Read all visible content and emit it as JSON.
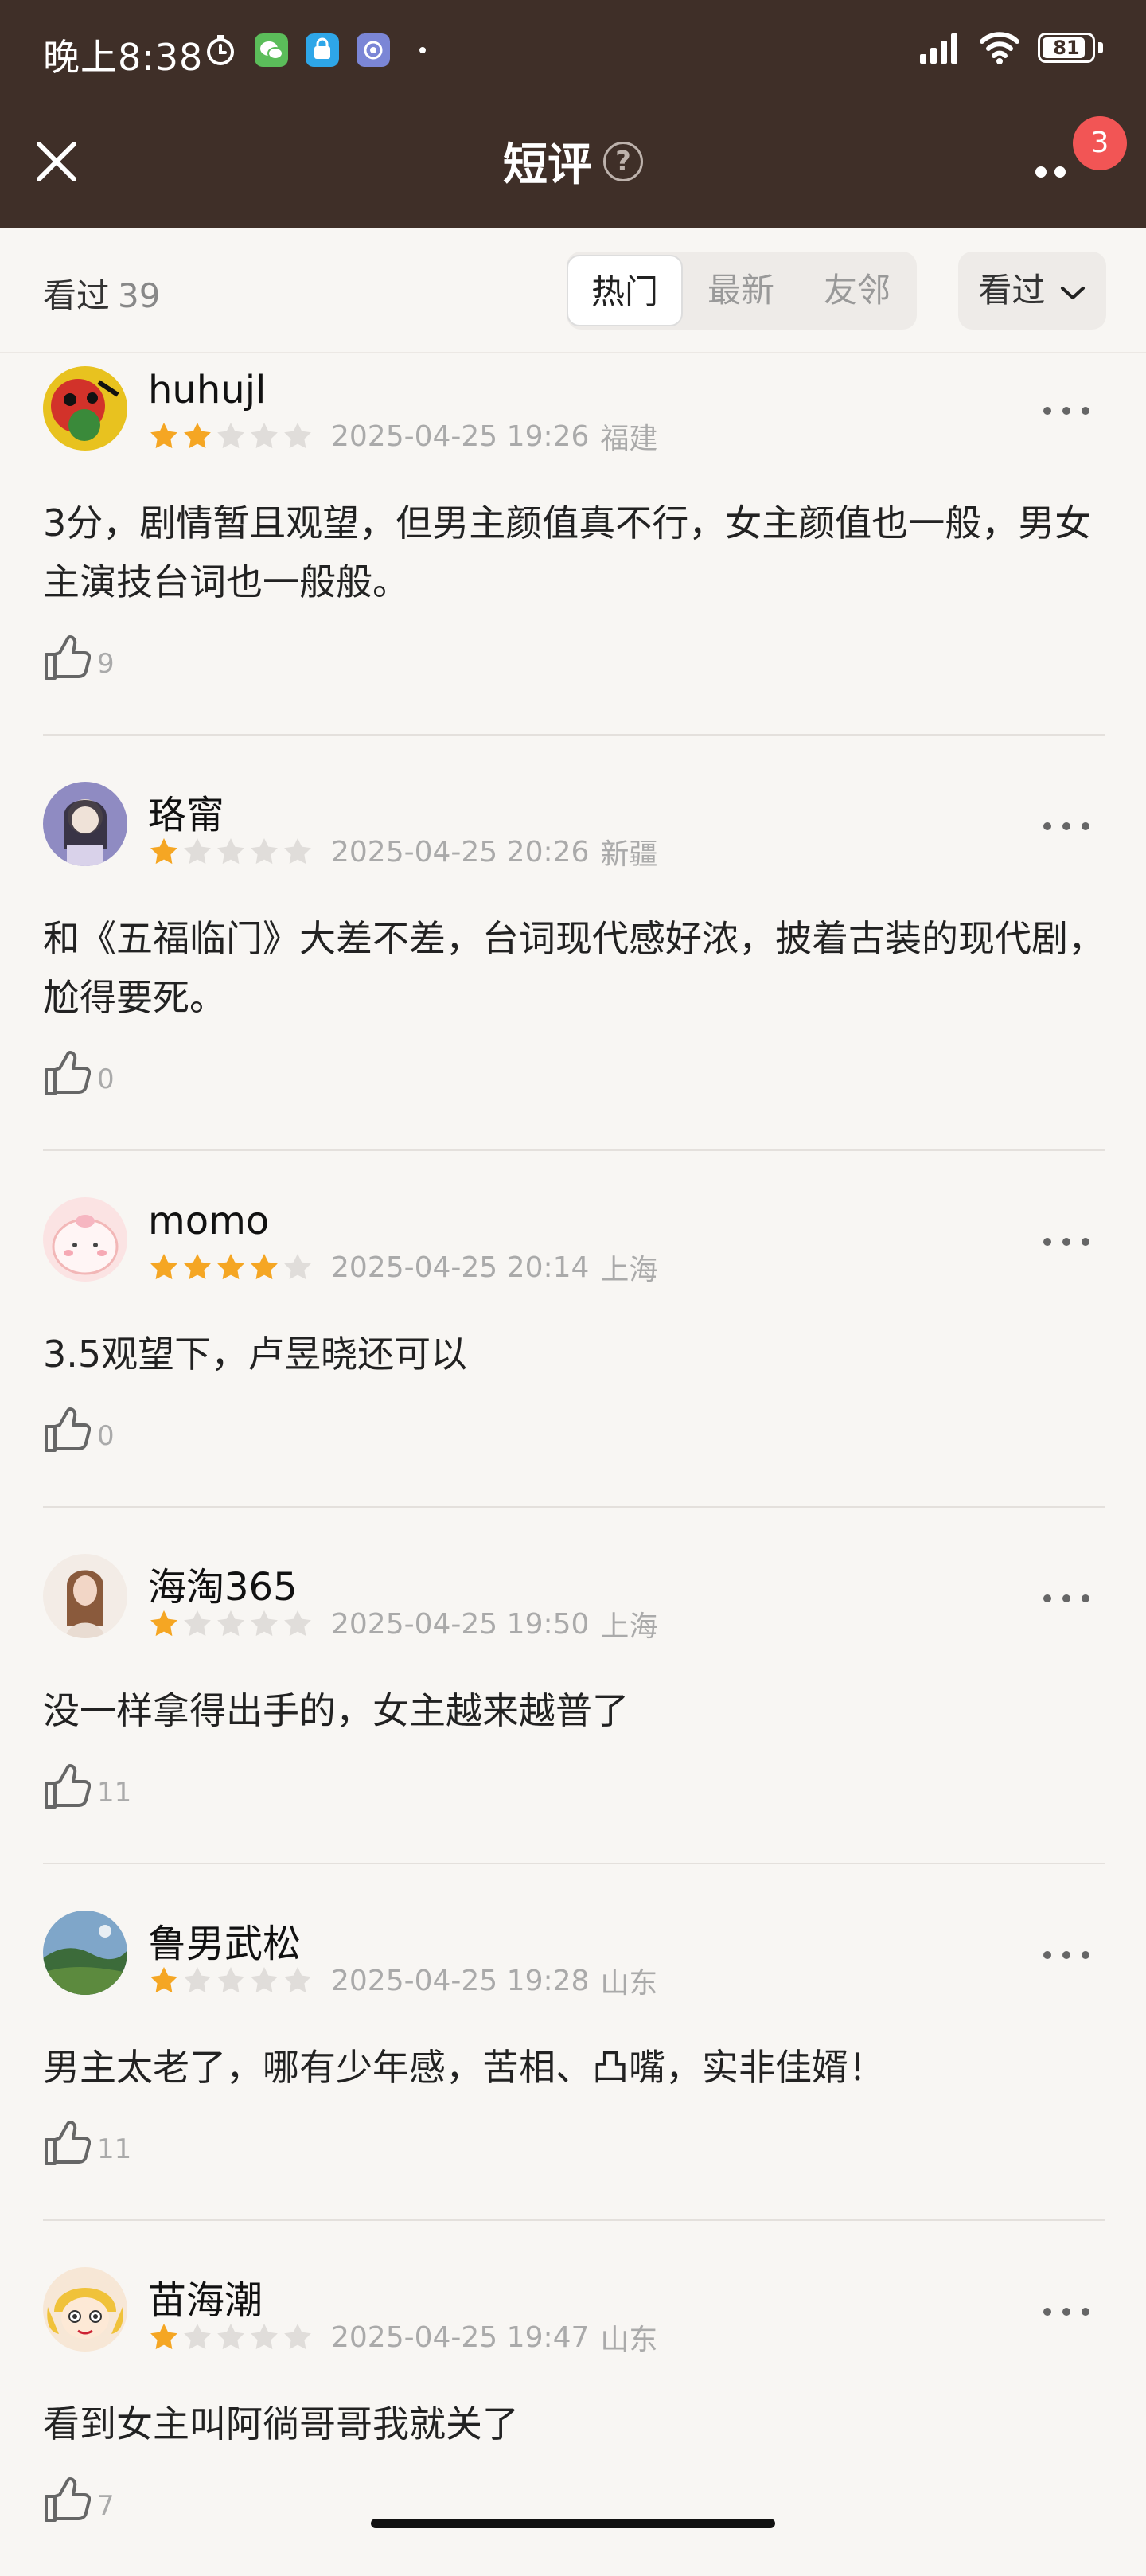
{
  "status_bar": {
    "time": "晚上8:38",
    "battery": "81",
    "icons": [
      "alarm-icon",
      "wechat-icon",
      "shopping-bag-icon",
      "app-icon",
      "dot-icon",
      "signal-icon",
      "wifi-icon",
      "battery-icon"
    ]
  },
  "header": {
    "title": "短评",
    "help_icon": "question-icon",
    "close_icon": "close-icon",
    "more_icon": "more-icon",
    "notification_badge": "3"
  },
  "filter": {
    "seen_label": "看过",
    "seen_count": "39",
    "tabs": [
      {
        "label": "热门",
        "active": true
      },
      {
        "label": "最新",
        "active": false
      },
      {
        "label": "友邻",
        "active": false
      }
    ],
    "dropdown_label": "看过"
  },
  "colors": {
    "header_bg": "#3f2f28",
    "star_filled": "#f5a623",
    "star_empty": "#e0ddda",
    "badge": "#f25555"
  },
  "comments": [
    {
      "user": "huhujl",
      "rating": 2,
      "time": "2025-04-25 19:26",
      "location": "福建",
      "text": "3分，剧情暂且观望，但男主颜值真不行，女主颜值也一般，男女主演技台词也一般般。",
      "likes": "9"
    },
    {
      "user": "珞甯",
      "rating": 1,
      "time": "2025-04-25 20:26",
      "location": "新疆",
      "text": "和《五福临门》大差不差，台词现代感好浓，披着古装的现代剧，尬得要死。",
      "likes": "0"
    },
    {
      "user": "momo",
      "rating": 4,
      "time": "2025-04-25 20:14",
      "location": "上海",
      "text": "3.5观望下，卢昱晓还可以",
      "likes": "0"
    },
    {
      "user": "海淘365",
      "rating": 1,
      "time": "2025-04-25 19:50",
      "location": "上海",
      "text": "没一样拿得出手的，女主越来越普了",
      "likes": "11"
    },
    {
      "user": "鲁男武松",
      "rating": 1,
      "time": "2025-04-25 19:28",
      "location": "山东",
      "text": "男主太老了，哪有少年感，苦相、凸嘴，实非佳婿！",
      "likes": "11"
    },
    {
      "user": "苗海潮",
      "rating": 1,
      "time": "2025-04-25 19:47",
      "location": "山东",
      "text": "看到女主叫阿徜哥哥我就关了",
      "likes": "7"
    }
  ]
}
